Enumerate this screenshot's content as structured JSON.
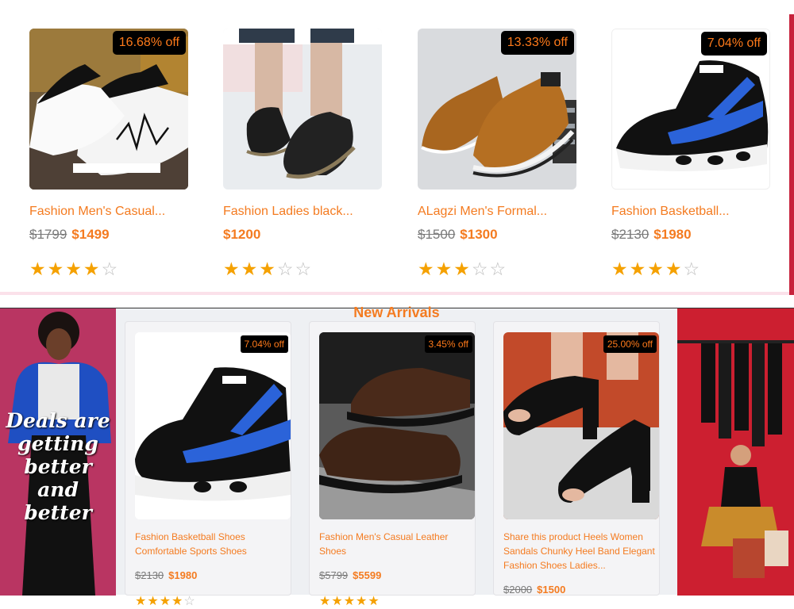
{
  "top_products": [
    {
      "title": "Fashion Men's Casual...",
      "old_price": "$1799",
      "new_price": "$1499",
      "discount": "16.68% off",
      "rating": 4,
      "image": "white-sneaker-image"
    },
    {
      "title": "Fashion Ladies black...",
      "old_price": "",
      "new_price": "$1200",
      "discount": "",
      "rating": 3,
      "image": "black-loafer-image"
    },
    {
      "title": "ALagzi Men's Formal...",
      "old_price": "$1500",
      "new_price": "$1300",
      "discount": "13.33% off",
      "rating": 3,
      "image": "brown-suede-shoe-image"
    },
    {
      "title": "Fashion Basketball...",
      "old_price": "$2130",
      "new_price": "$1980",
      "discount": "7.04% off",
      "rating": 4,
      "image": "basketball-shoe-image"
    }
  ],
  "new_arrivals": {
    "title": "New Arrivals",
    "promo_text": "Deals are getting better and better",
    "products": [
      {
        "title": "Fashion Basketball Shoes Comfortable Sports Shoes",
        "old_price": "$2130",
        "new_price": "$1980",
        "discount": "7.04% off",
        "rating": 4,
        "image": "basketball-shoe-image"
      },
      {
        "title": "Fashion Men's Casual Leather Shoes",
        "old_price": "$5799",
        "new_price": "$5599",
        "discount": "3.45% off",
        "rating": 5,
        "image": "leather-shoe-image"
      },
      {
        "title": "Share this product Heels Women Sandals Chunky Heel Band Elegant Fashion Shoes Ladies...",
        "old_price": "$2000",
        "new_price": "$1500",
        "discount": "25.00% off",
        "rating": 0,
        "image": "heel-sandal-image"
      }
    ]
  },
  "colors": {
    "accent": "#f47b20",
    "star": "#f5a100",
    "badge_bg": "#000000"
  },
  "star_glyphs": {
    "on": "★",
    "off": "☆"
  }
}
